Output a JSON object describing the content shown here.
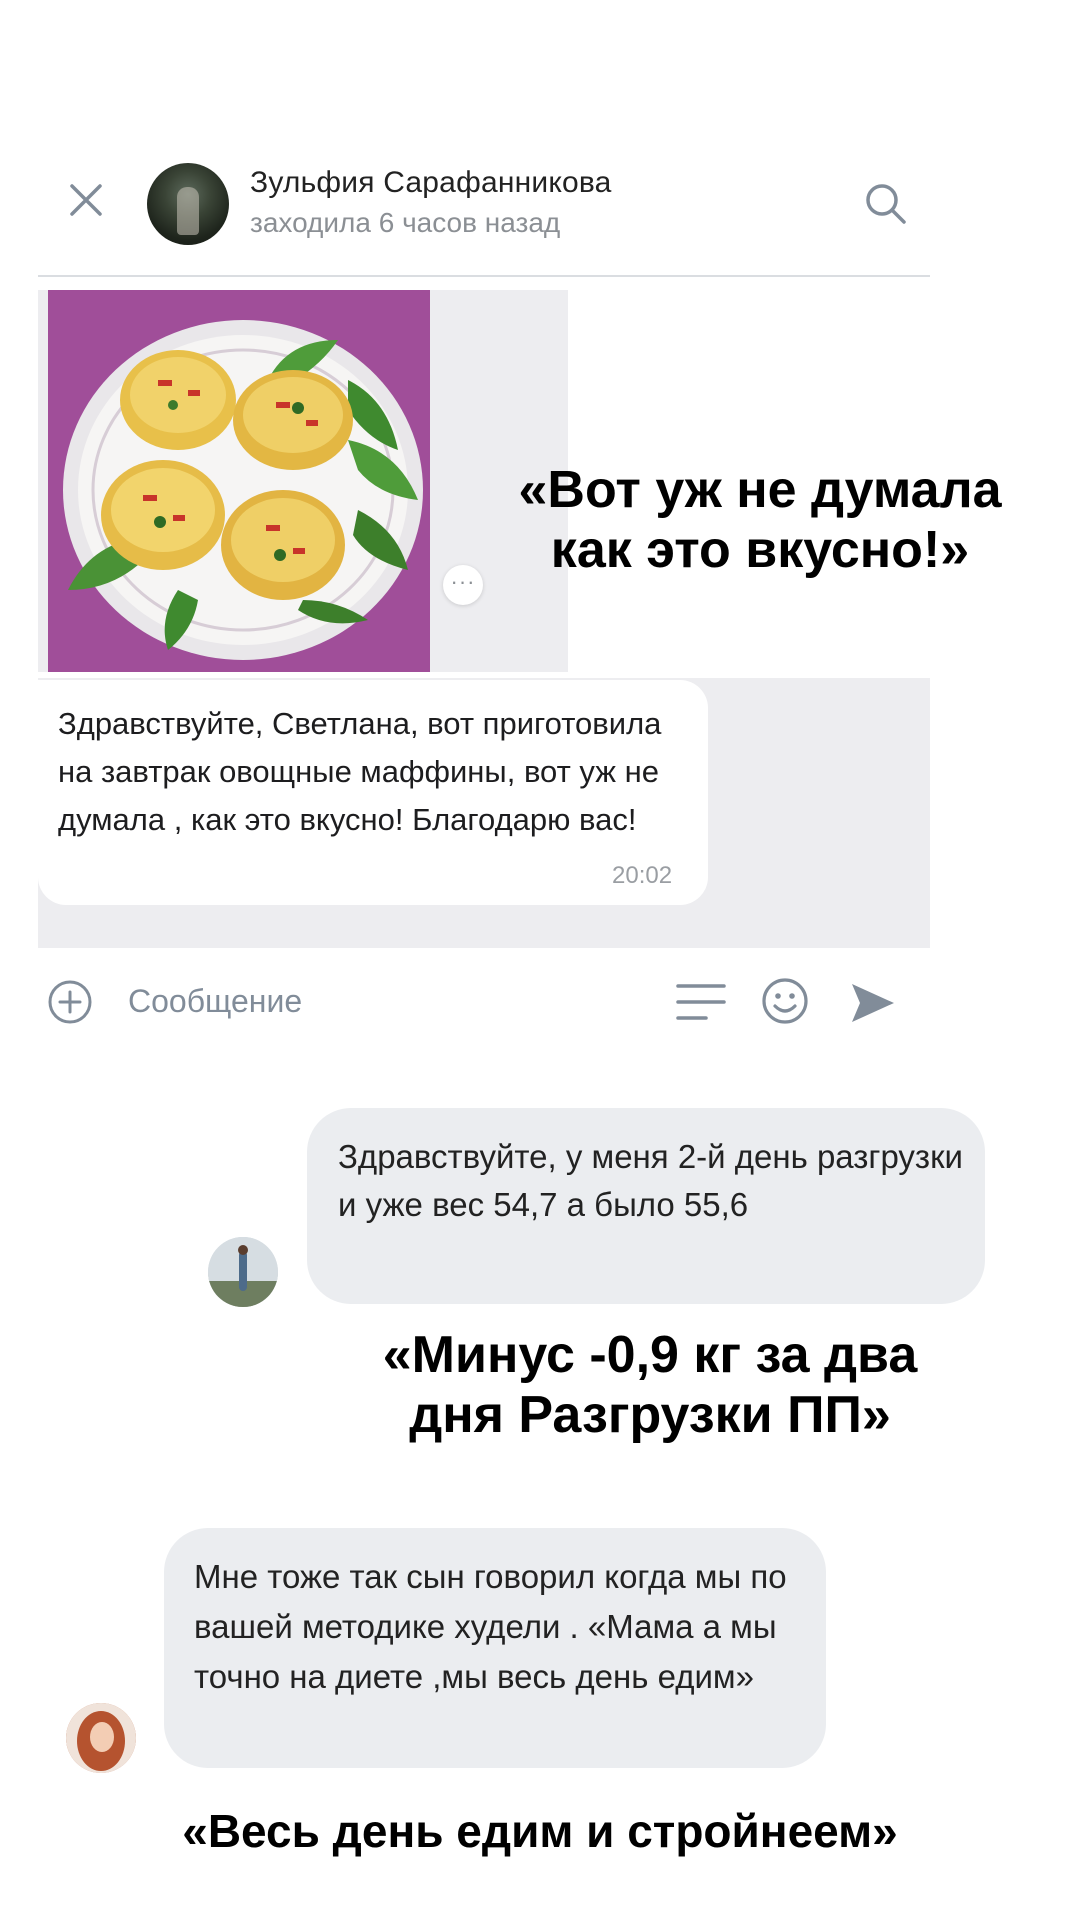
{
  "chat_header": {
    "name": "Зульфия Сарафанникова",
    "status": "заходила 6 часов назад",
    "icons": {
      "close": "close-icon",
      "search": "search-icon"
    }
  },
  "message_1": {
    "text": "Здравствуйте, Светлана, вот приготовила на завтрак овощные маффины, вот уж не думала , как это вкусно! Благодарю вас!",
    "time": "20:02",
    "more_label": "···"
  },
  "composer": {
    "placeholder": "Сообщение",
    "icons": {
      "add": "add-circle-icon",
      "keyboard": "bot-keyboard-icon",
      "emoji": "emoji-icon",
      "send": "send-icon"
    }
  },
  "quotes": {
    "q1": "«Вот уж не думала как это вкусно!»",
    "q2": "«Минус -0,9 кг за два дня Разгрузки ПП»",
    "q3": "«Весь день едим и стройнеем»"
  },
  "message_2": {
    "text": "Здравствуйте, у меня 2-й день разгрузки и уже вес 54,7 а было 55,6"
  },
  "message_3": {
    "text": "Мне тоже так сын говорил когда мы по вашей методике худели . «Мама а мы точно на диете ,мы весь день едим»"
  },
  "colors": {
    "bubble_gray": "#ebedf0",
    "chat_bg": "#ededf0",
    "muted_text": "#8b8f94",
    "photo_bg": "#9b4a94"
  }
}
